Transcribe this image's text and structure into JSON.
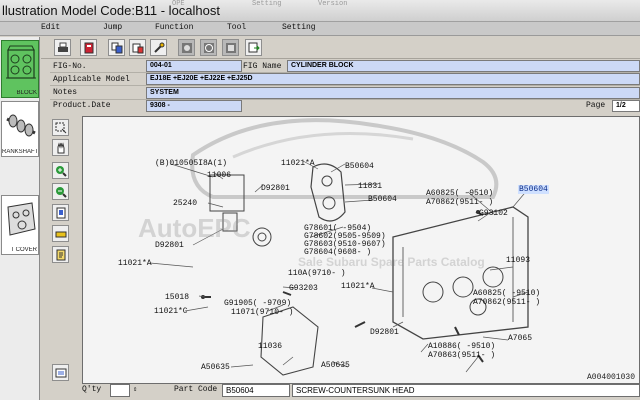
{
  "window": {
    "title": "llustration Model Code:B11 - localhost",
    "ghost_menu": [
      "OPE",
      "Setting",
      "Version"
    ]
  },
  "menu": [
    "Edit",
    "Jump",
    "Function",
    "Tool",
    "Setting"
  ],
  "thumbnails": [
    {
      "label": "BLOCK",
      "icon": "engine-block-icon",
      "selected": true
    },
    {
      "label": "RANKSHAFT",
      "icon": "crankshaft-icon",
      "selected": false
    },
    {
      "label": "T COVER",
      "icon": "timing-cover-icon",
      "selected": false
    }
  ],
  "toolbar_icons": [
    "print-icon",
    "book-icon",
    "copy-icon",
    "list-icon",
    "wrench-icon",
    "view-full-icon",
    "view-zoom-icon",
    "view-detail-icon",
    "export-icon"
  ],
  "info": {
    "fig_no_label": "FIG-No.",
    "fig_no": "004-01",
    "fig_name_label": "FIG Name",
    "fig_name": "CYLINDER BLOCK",
    "applicable_label": "Applicable Model",
    "applicable": "EJ18E +EJ20E +EJ22E +EJ25D",
    "notes_label": "Notes",
    "notes": "SYSTEM",
    "product_date_label": "Product.Date",
    "product_date": "9308 -",
    "page_label": "Page",
    "page_value": "1/2"
  },
  "vtools": [
    "select-area-icon",
    "hand-pan-icon",
    "zoom-in-icon",
    "zoom-out-icon",
    "page-icon",
    "warning-icon",
    "notes-icon"
  ],
  "diagram": {
    "labels": [
      "(B)010505I8A(1)",
      "11006",
      "11021*A",
      "B50604",
      "D92801",
      "11831",
      "B50604",
      "25240",
      "A60825(  -9510)",
      "A70862(9511-  )",
      "B50604",
      "G93102",
      "G78601( -9504)",
      "G78602(9505-9509)",
      "G78603(9510-9607)",
      "G78604(9608-  )",
      "D92801",
      "11021*A",
      "110A(9710-  )",
      "G93203",
      "11093",
      "15018",
      "11021*A",
      "G91905(  -9709)",
      "11071(9710-  )",
      "A60825(  -9510)",
      "A70862(9511-  )",
      "11021*C",
      "D92801",
      "A7065",
      "11036",
      "A10886(  -9510)",
      "A70863(9511-  )",
      "A50635",
      "A50635"
    ],
    "watermark": "Sale Subaru Spare Parts Catalog",
    "watermark_brand": "AutoEPC",
    "figure_id": "A004001030"
  },
  "bottom": {
    "qty_label": "Q'ty",
    "qty_value": "",
    "part_code_label": "Part Code",
    "part_code": "B50604",
    "part_name": "SCREW-COUNTERSUNK HEAD"
  }
}
